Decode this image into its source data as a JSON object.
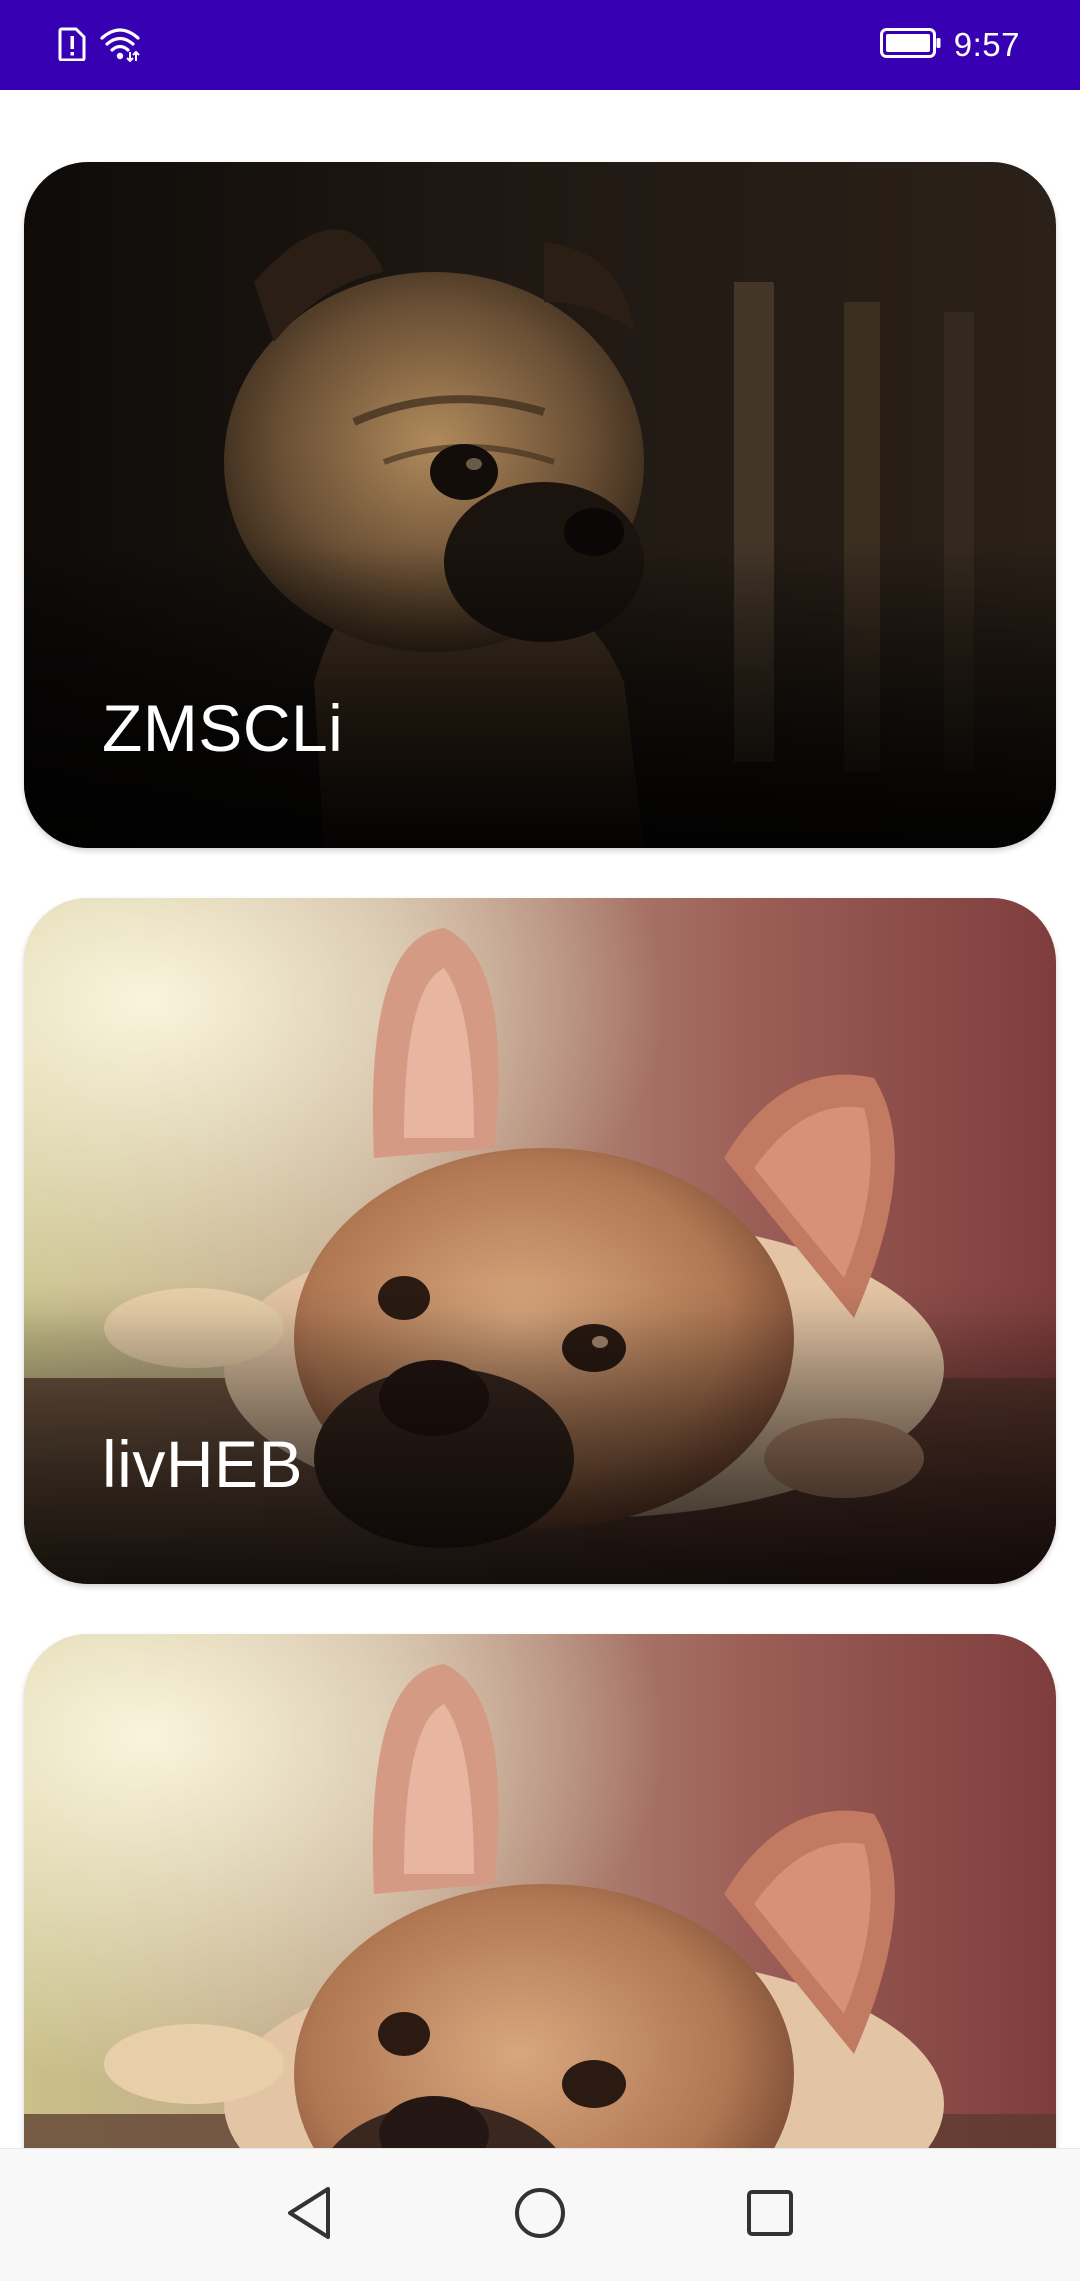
{
  "status_bar": {
    "time": "9:57",
    "background": "#3700b3",
    "icons": [
      "sim-alert-icon",
      "wifi-icon",
      "battery-icon"
    ]
  },
  "cards": [
    {
      "title": "ZMSCLi",
      "image": "pug-photo"
    },
    {
      "title": "livHEB",
      "image": "french-bulldog-photo"
    },
    {
      "title": "",
      "image": "french-bulldog-photo"
    }
  ],
  "nav_bar": {
    "icons": [
      "back-icon",
      "home-icon",
      "recents-icon"
    ]
  }
}
